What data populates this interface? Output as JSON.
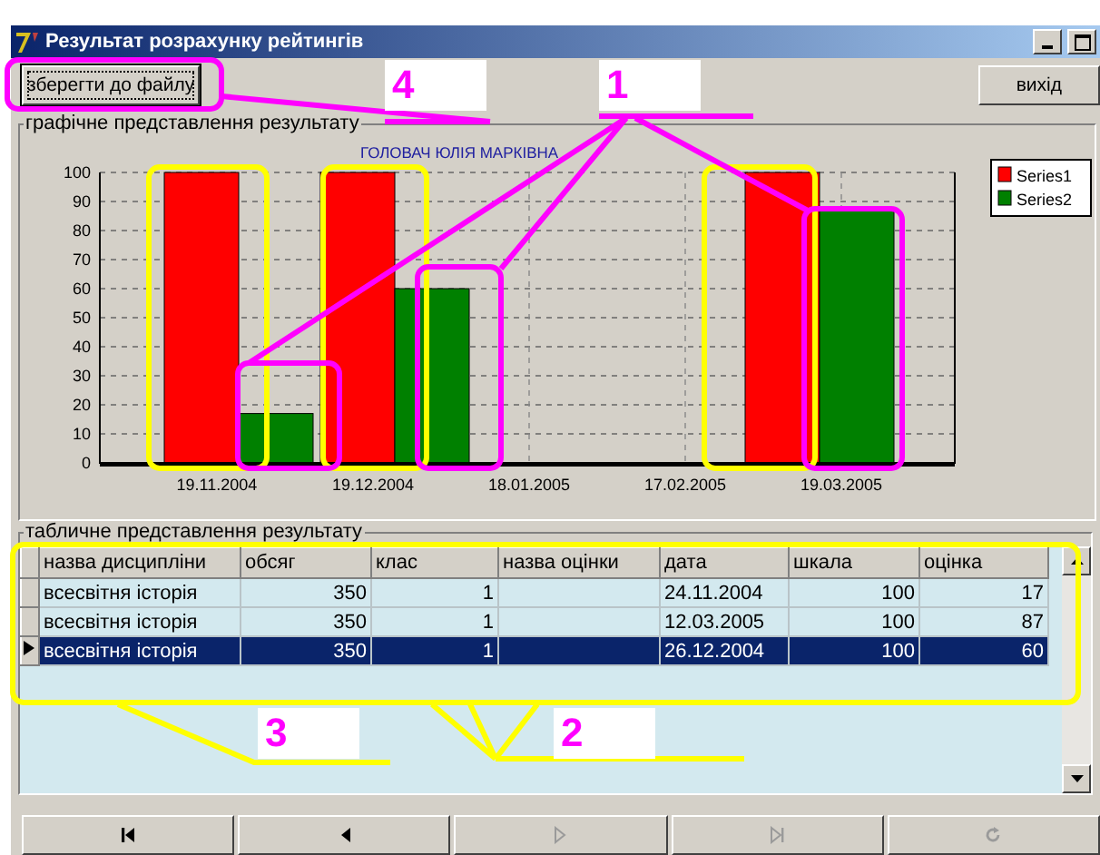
{
  "window": {
    "title": "Результат розрахунку рейтингів"
  },
  "toolbar": {
    "buttons": [
      {
        "label": "зберегти до файлу",
        "focused": true
      },
      {
        "label": "вихід",
        "focused": false
      }
    ]
  },
  "chart_group": {
    "caption": "графічне представлення результату",
    "chart_data": {
      "type": "bar",
      "grid": true,
      "legend": "top-right",
      "title": "ГОЛОВАЧ ЮЛІЯ МАРКІВНА",
      "categories": [
        "19.11.2004",
        "19.12.2004",
        "18.01.2005",
        "17.02.2005",
        "19.03.2005"
      ],
      "ylim": [
        0,
        100
      ],
      "yticks": [
        0,
        10,
        20,
        30,
        40,
        50,
        60,
        70,
        80,
        90,
        100
      ],
      "series": [
        {
          "name": "Series1",
          "color": "#ff0000",
          "values": [
            100,
            100,
            null,
            null,
            100
          ]
        },
        {
          "name": "Series2",
          "color": "#008000",
          "values": [
            17,
            60,
            null,
            null,
            87
          ]
        }
      ]
    }
  },
  "table_group": {
    "caption": "табличне представлення результату",
    "columns": [
      "назва дисципліни",
      "обсяг",
      "клас",
      "назва оцінки",
      "дата",
      "шкала",
      "оцінка"
    ],
    "rows": [
      {
        "cells": [
          "всесвітня історія",
          "350",
          "1",
          "",
          "24.11.2004",
          "100",
          "17"
        ],
        "selected": false
      },
      {
        "cells": [
          "всесвітня історія",
          "350",
          "1",
          "",
          "12.03.2005",
          "100",
          "87"
        ],
        "selected": false
      },
      {
        "cells": [
          "всесвітня історія",
          "350",
          "1",
          "",
          "26.12.2004",
          "100",
          "60"
        ],
        "selected": true
      }
    ]
  },
  "navigator": [
    {
      "kind": "first",
      "disabled": false
    },
    {
      "kind": "prior",
      "disabled": false
    },
    {
      "kind": "next",
      "disabled": true
    },
    {
      "kind": "last",
      "disabled": true
    },
    {
      "kind": "refresh",
      "disabled": true
    }
  ],
  "annotations": [
    {
      "label": "4"
    },
    {
      "label": "1"
    },
    {
      "label": "3"
    },
    {
      "label": "2"
    }
  ]
}
